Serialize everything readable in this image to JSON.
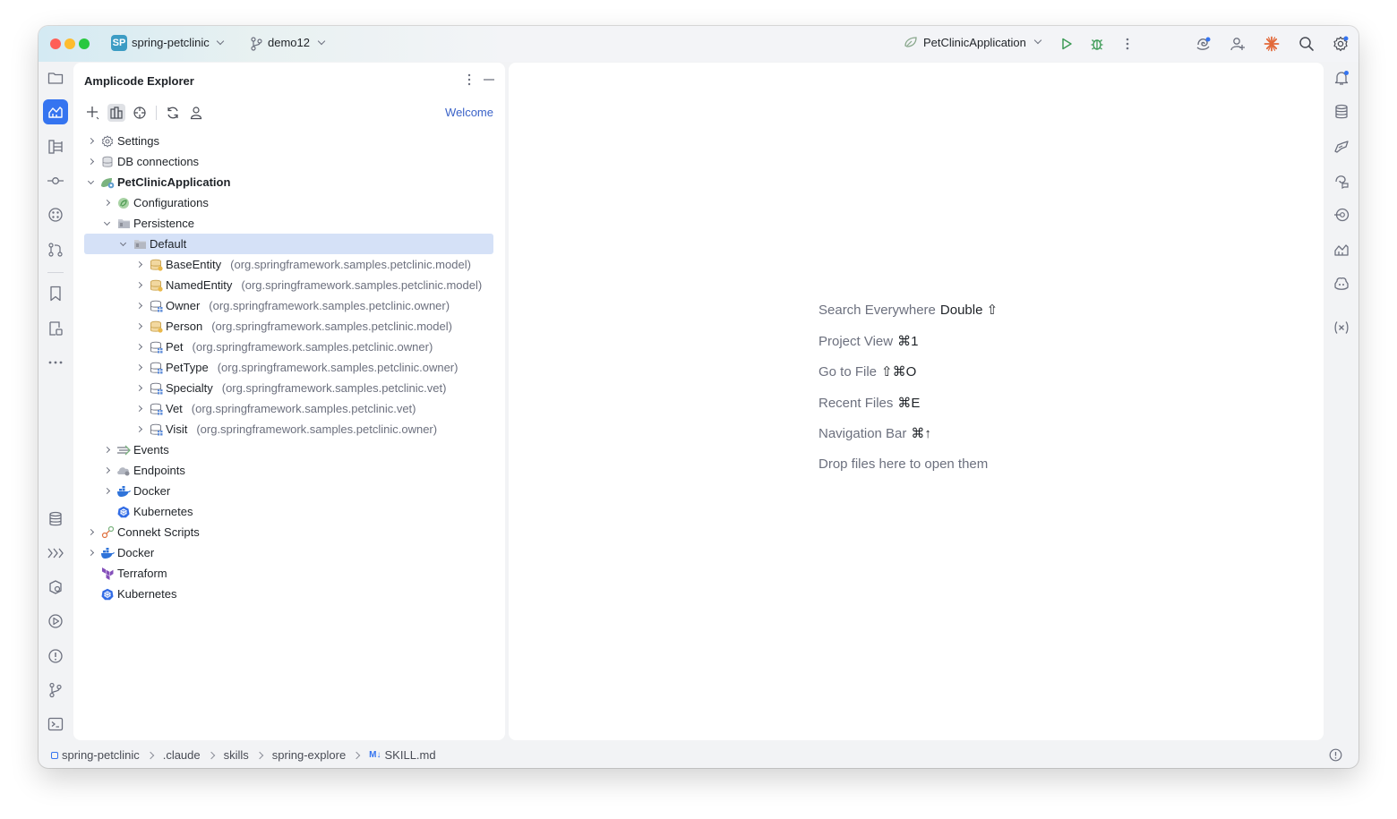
{
  "titlebar": {
    "project_badge": "SP",
    "project_name": "spring-petclinic",
    "branch": "demo12",
    "run_configuration": "PetClinicApplication"
  },
  "explorer": {
    "title": "Amplicode Explorer",
    "welcome_link": "Welcome",
    "tree": [
      {
        "label": "Settings",
        "package": "",
        "level": 0,
        "state": "collapsed",
        "icon": "gear-icon"
      },
      {
        "label": "DB connections",
        "package": "",
        "level": 0,
        "state": "collapsed",
        "icon": "database-icon"
      },
      {
        "label": "PetClinicApplication",
        "package": "",
        "level": 0,
        "state": "expanded",
        "icon": "spring-app-icon",
        "bold": true
      },
      {
        "label": "Configurations",
        "package": "",
        "level": 1,
        "state": "collapsed",
        "icon": "spring-config-icon"
      },
      {
        "label": "Persistence",
        "package": "",
        "level": 1,
        "state": "expanded",
        "icon": "folder-icon"
      },
      {
        "label": "Default",
        "package": "",
        "level": 2,
        "state": "expanded",
        "icon": "folder-icon",
        "selected": true
      },
      {
        "label": "BaseEntity",
        "package": "(org.springframework.samples.petclinic.model)",
        "level": 3,
        "state": "collapsed",
        "icon": "mapped-superclass-icon"
      },
      {
        "label": "NamedEntity",
        "package": "(org.springframework.samples.petclinic.model)",
        "level": 3,
        "state": "collapsed",
        "icon": "mapped-superclass-icon"
      },
      {
        "label": "Owner",
        "package": "(org.springframework.samples.petclinic.owner)",
        "level": 3,
        "state": "collapsed",
        "icon": "entity-icon"
      },
      {
        "label": "Person",
        "package": "(org.springframework.samples.petclinic.model)",
        "level": 3,
        "state": "collapsed",
        "icon": "mapped-superclass-icon"
      },
      {
        "label": "Pet",
        "package": "(org.springframework.samples.petclinic.owner)",
        "level": 3,
        "state": "collapsed",
        "icon": "entity-icon"
      },
      {
        "label": "PetType",
        "package": "(org.springframework.samples.petclinic.owner)",
        "level": 3,
        "state": "collapsed",
        "icon": "entity-icon"
      },
      {
        "label": "Specialty",
        "package": "(org.springframework.samples.petclinic.vet)",
        "level": 3,
        "state": "collapsed",
        "icon": "entity-icon"
      },
      {
        "label": "Vet",
        "package": "(org.springframework.samples.petclinic.vet)",
        "level": 3,
        "state": "collapsed",
        "icon": "entity-icon"
      },
      {
        "label": "Visit",
        "package": "(org.springframework.samples.petclinic.owner)",
        "level": 3,
        "state": "collapsed",
        "icon": "entity-icon"
      },
      {
        "label": "Events",
        "package": "",
        "level": 1,
        "state": "collapsed",
        "icon": "events-icon"
      },
      {
        "label": "Endpoints",
        "package": "",
        "level": 1,
        "state": "collapsed",
        "icon": "endpoints-icon"
      },
      {
        "label": "Docker",
        "package": "",
        "level": 1,
        "state": "collapsed",
        "icon": "docker-icon"
      },
      {
        "label": "Kubernetes",
        "package": "",
        "level": 1,
        "state": "leaf",
        "icon": "kubernetes-icon"
      },
      {
        "label": "Connekt Scripts",
        "package": "",
        "level": 0,
        "state": "collapsed",
        "icon": "connekt-icon"
      },
      {
        "label": "Docker",
        "package": "",
        "level": 0,
        "state": "collapsed",
        "icon": "docker-icon"
      },
      {
        "label": "Terraform",
        "package": "",
        "level": 0,
        "state": "leaf",
        "icon": "terraform-icon"
      },
      {
        "label": "Kubernetes",
        "package": "",
        "level": 0,
        "state": "leaf",
        "icon": "kubernetes-icon"
      }
    ]
  },
  "editor": {
    "hints": [
      {
        "action": "Search Everywhere",
        "shortcut": "Double ⇧"
      },
      {
        "action": "Project View",
        "shortcut": "⌘1"
      },
      {
        "action": "Go to File",
        "shortcut": "⇧⌘O"
      },
      {
        "action": "Recent Files",
        "shortcut": "⌘E"
      },
      {
        "action": "Navigation Bar",
        "shortcut": "⌘↑"
      },
      {
        "action": "Drop files here to open them",
        "shortcut": ""
      }
    ]
  },
  "statusbar": {
    "breadcrumbs": [
      "spring-petclinic",
      ".claude",
      "skills",
      "spring-explore",
      "SKILL.md"
    ],
    "file_badge": "M↓"
  },
  "colors": {
    "accent": "#3574f0",
    "selection": "#d5e1f7",
    "link": "#3b63c8",
    "hint_text": "#6c707e"
  }
}
